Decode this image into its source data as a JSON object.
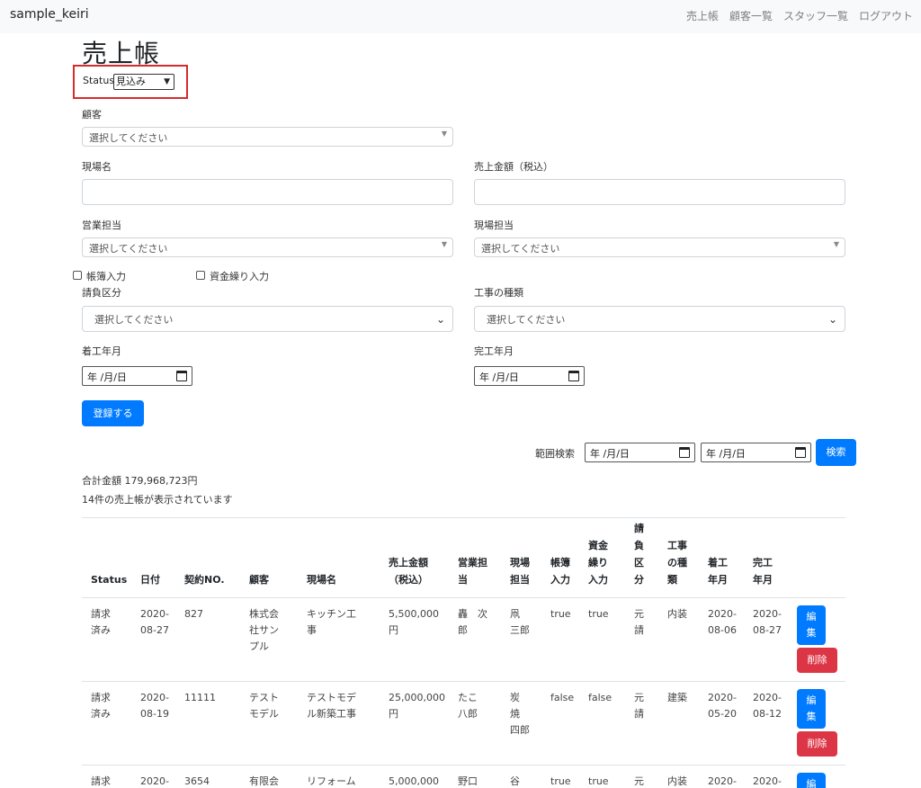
{
  "navbar": {
    "brand": "sample_keiri",
    "links": [
      "売上帳",
      "顧客一覧",
      "スタッフ一覧",
      "ログアウト"
    ]
  },
  "page_title": "売上帳",
  "status_filter": {
    "label": "Status",
    "value": "見込み"
  },
  "form": {
    "customer": {
      "label": "顧客",
      "placeholder": "選択してください"
    },
    "site_name": {
      "label": "現場名",
      "value": ""
    },
    "sales_amount": {
      "label": "売上金額（税込）",
      "value": ""
    },
    "sales_staff": {
      "label": "営業担当",
      "placeholder": "選択してください"
    },
    "site_staff": {
      "label": "現場担当",
      "placeholder": "選択してください"
    },
    "ledger_entry": {
      "label": "帳簿入力"
    },
    "cashflow_entry": {
      "label": "資金繰り入力"
    },
    "contract_type": {
      "label": "請負区分",
      "placeholder": "選択してください"
    },
    "work_type": {
      "label": "工事の種類",
      "placeholder": "選択してください"
    },
    "start_month": {
      "label": "着工年月",
      "placeholder": "年 /月/日"
    },
    "end_month": {
      "label": "完工年月",
      "placeholder": "年 /月/日"
    },
    "submit_label": "登録する"
  },
  "range_search": {
    "label": "範囲検索",
    "from_placeholder": "年 /月/日",
    "to_placeholder": "年 /月/日",
    "button_label": "検索"
  },
  "summary": {
    "total": "合計金額 179,968,723円",
    "count": "14件の売上帳が表示されています"
  },
  "table": {
    "headers": [
      "Status",
      "日付",
      "契約NO.",
      "顧客",
      "現場名",
      "売上金額\n（税込）",
      "営業担\n当",
      "現場\n担当",
      "帳簿\n入力",
      "資金\n繰り\n入力",
      "請\n負\n区\n分",
      "工事\nの種\n類",
      "着工\n年月",
      "完工\n年月"
    ],
    "edit_label": "編\n集",
    "delete_label": "削除",
    "rows": [
      [
        "請求\n済み",
        "2020-\n08-27",
        "827",
        "株式会\n社サン\nプル",
        "キッチン工\n事",
        "5,500,000\n円",
        "轟　次\n郎",
        "凧\n三郎",
        "true",
        "true",
        "元\n請",
        "内装",
        "2020-\n08-06",
        "2020-\n08-27"
      ],
      [
        "請求\n済み",
        "2020-\n08-19",
        "11111",
        "テスト\nモデル",
        "テストモデ\nル新築工事",
        "25,000,000\n円",
        "たこ\n八郎",
        "炭\n焼\n四郎",
        "false",
        "false",
        "元\n請",
        "建築",
        "2020-\n05-20",
        "2020-\n08-12"
      ],
      [
        "請求",
        "2020-",
        "3654",
        "有限会",
        "リフォーム",
        "5,000,000",
        "野口",
        "谷",
        "true",
        "true",
        "元",
        "内装",
        "2020-",
        "2020-"
      ]
    ]
  }
}
